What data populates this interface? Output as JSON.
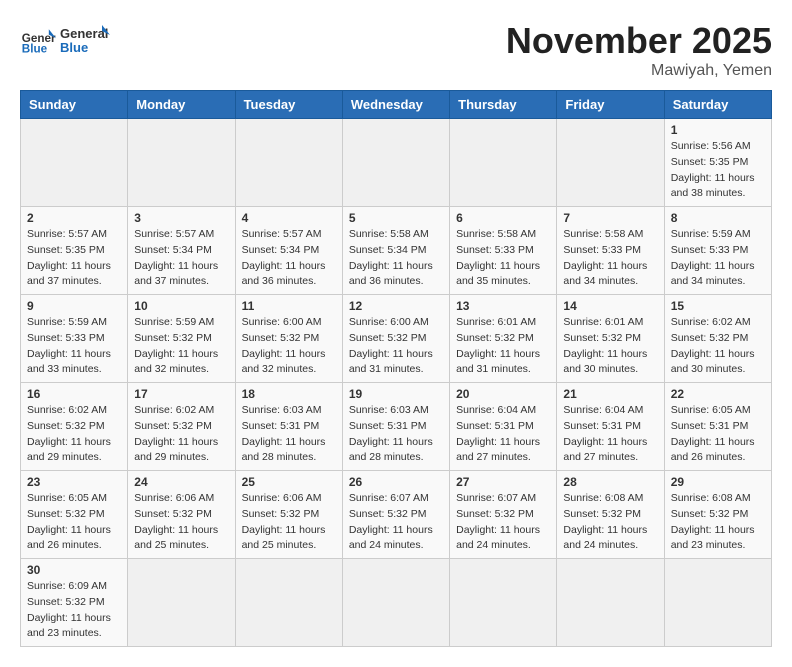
{
  "header": {
    "logo_general": "General",
    "logo_blue": "Blue",
    "month_title": "November 2025",
    "location": "Mawiyah, Yemen"
  },
  "weekdays": [
    "Sunday",
    "Monday",
    "Tuesday",
    "Wednesday",
    "Thursday",
    "Friday",
    "Saturday"
  ],
  "days": [
    {
      "day": "",
      "info": ""
    },
    {
      "day": "",
      "info": ""
    },
    {
      "day": "",
      "info": ""
    },
    {
      "day": "",
      "info": ""
    },
    {
      "day": "",
      "info": ""
    },
    {
      "day": "",
      "info": ""
    },
    {
      "day": "1",
      "info": "Sunrise: 5:56 AM\nSunset: 5:35 PM\nDaylight: 11 hours and 38 minutes."
    },
    {
      "day": "2",
      "info": "Sunrise: 5:57 AM\nSunset: 5:35 PM\nDaylight: 11 hours and 37 minutes."
    },
    {
      "day": "3",
      "info": "Sunrise: 5:57 AM\nSunset: 5:34 PM\nDaylight: 11 hours and 37 minutes."
    },
    {
      "day": "4",
      "info": "Sunrise: 5:57 AM\nSunset: 5:34 PM\nDaylight: 11 hours and 36 minutes."
    },
    {
      "day": "5",
      "info": "Sunrise: 5:58 AM\nSunset: 5:34 PM\nDaylight: 11 hours and 36 minutes."
    },
    {
      "day": "6",
      "info": "Sunrise: 5:58 AM\nSunset: 5:33 PM\nDaylight: 11 hours and 35 minutes."
    },
    {
      "day": "7",
      "info": "Sunrise: 5:58 AM\nSunset: 5:33 PM\nDaylight: 11 hours and 34 minutes."
    },
    {
      "day": "8",
      "info": "Sunrise: 5:59 AM\nSunset: 5:33 PM\nDaylight: 11 hours and 34 minutes."
    },
    {
      "day": "9",
      "info": "Sunrise: 5:59 AM\nSunset: 5:33 PM\nDaylight: 11 hours and 33 minutes."
    },
    {
      "day": "10",
      "info": "Sunrise: 5:59 AM\nSunset: 5:32 PM\nDaylight: 11 hours and 32 minutes."
    },
    {
      "day": "11",
      "info": "Sunrise: 6:00 AM\nSunset: 5:32 PM\nDaylight: 11 hours and 32 minutes."
    },
    {
      "day": "12",
      "info": "Sunrise: 6:00 AM\nSunset: 5:32 PM\nDaylight: 11 hours and 31 minutes."
    },
    {
      "day": "13",
      "info": "Sunrise: 6:01 AM\nSunset: 5:32 PM\nDaylight: 11 hours and 31 minutes."
    },
    {
      "day": "14",
      "info": "Sunrise: 6:01 AM\nSunset: 5:32 PM\nDaylight: 11 hours and 30 minutes."
    },
    {
      "day": "15",
      "info": "Sunrise: 6:02 AM\nSunset: 5:32 PM\nDaylight: 11 hours and 30 minutes."
    },
    {
      "day": "16",
      "info": "Sunrise: 6:02 AM\nSunset: 5:32 PM\nDaylight: 11 hours and 29 minutes."
    },
    {
      "day": "17",
      "info": "Sunrise: 6:02 AM\nSunset: 5:32 PM\nDaylight: 11 hours and 29 minutes."
    },
    {
      "day": "18",
      "info": "Sunrise: 6:03 AM\nSunset: 5:31 PM\nDaylight: 11 hours and 28 minutes."
    },
    {
      "day": "19",
      "info": "Sunrise: 6:03 AM\nSunset: 5:31 PM\nDaylight: 11 hours and 28 minutes."
    },
    {
      "day": "20",
      "info": "Sunrise: 6:04 AM\nSunset: 5:31 PM\nDaylight: 11 hours and 27 minutes."
    },
    {
      "day": "21",
      "info": "Sunrise: 6:04 AM\nSunset: 5:31 PM\nDaylight: 11 hours and 27 minutes."
    },
    {
      "day": "22",
      "info": "Sunrise: 6:05 AM\nSunset: 5:31 PM\nDaylight: 11 hours and 26 minutes."
    },
    {
      "day": "23",
      "info": "Sunrise: 6:05 AM\nSunset: 5:32 PM\nDaylight: 11 hours and 26 minutes."
    },
    {
      "day": "24",
      "info": "Sunrise: 6:06 AM\nSunset: 5:32 PM\nDaylight: 11 hours and 25 minutes."
    },
    {
      "day": "25",
      "info": "Sunrise: 6:06 AM\nSunset: 5:32 PM\nDaylight: 11 hours and 25 minutes."
    },
    {
      "day": "26",
      "info": "Sunrise: 6:07 AM\nSunset: 5:32 PM\nDaylight: 11 hours and 24 minutes."
    },
    {
      "day": "27",
      "info": "Sunrise: 6:07 AM\nSunset: 5:32 PM\nDaylight: 11 hours and 24 minutes."
    },
    {
      "day": "28",
      "info": "Sunrise: 6:08 AM\nSunset: 5:32 PM\nDaylight: 11 hours and 24 minutes."
    },
    {
      "day": "29",
      "info": "Sunrise: 6:08 AM\nSunset: 5:32 PM\nDaylight: 11 hours and 23 minutes."
    },
    {
      "day": "30",
      "info": "Sunrise: 6:09 AM\nSunset: 5:32 PM\nDaylight: 11 hours and 23 minutes."
    },
    {
      "day": "",
      "info": ""
    },
    {
      "day": "",
      "info": ""
    },
    {
      "day": "",
      "info": ""
    },
    {
      "day": "",
      "info": ""
    },
    {
      "day": "",
      "info": ""
    },
    {
      "day": "",
      "info": ""
    }
  ],
  "accent_color": "#2a6db5"
}
